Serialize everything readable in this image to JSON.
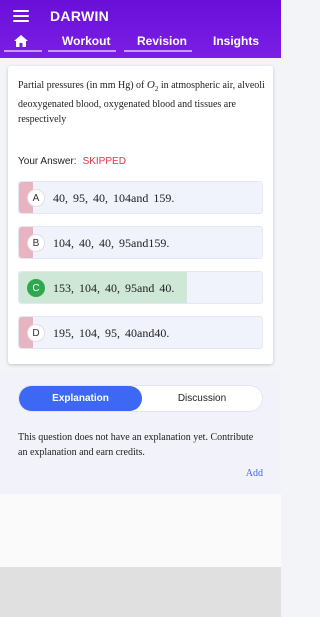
{
  "app": {
    "title": "DARWIN"
  },
  "tabs": [
    {
      "label": "Workout"
    },
    {
      "label": "Revision"
    },
    {
      "label": "Insights"
    }
  ],
  "question": {
    "text_before": "Partial pressures (in mm Hg) of ",
    "formula_symbol": "O",
    "formula_subscript": "2",
    "text_after": " in atmospheric air, alveoli deoxygenated blood, oxygenated blood and tissues are respectively"
  },
  "answer": {
    "label": "Your Answer:",
    "status": "SKIPPED"
  },
  "options": [
    {
      "letter": "A",
      "text": "40,  95,  40,  104and 159."
    },
    {
      "letter": "B",
      "text": "104,  40,  40,  95and159."
    },
    {
      "letter": "C",
      "text": "153,  104,  40,  95and 40."
    },
    {
      "letter": "D",
      "text": "195,  104,  95,  40and40."
    }
  ],
  "panel": {
    "tab_active": "Explanation",
    "tab_inactive": "Discussion",
    "message": "This question does not have an explanation yet. Contribute an explanation and earn credits.",
    "add_label": "Add"
  },
  "colors": {
    "header": "#7b1fe6",
    "accent": "#3d68f4",
    "skipped": "#e0314b",
    "correct": "#2fa84f",
    "correct_fill": "#cfe7d6",
    "wrong_strip": "#e8b4c2"
  }
}
